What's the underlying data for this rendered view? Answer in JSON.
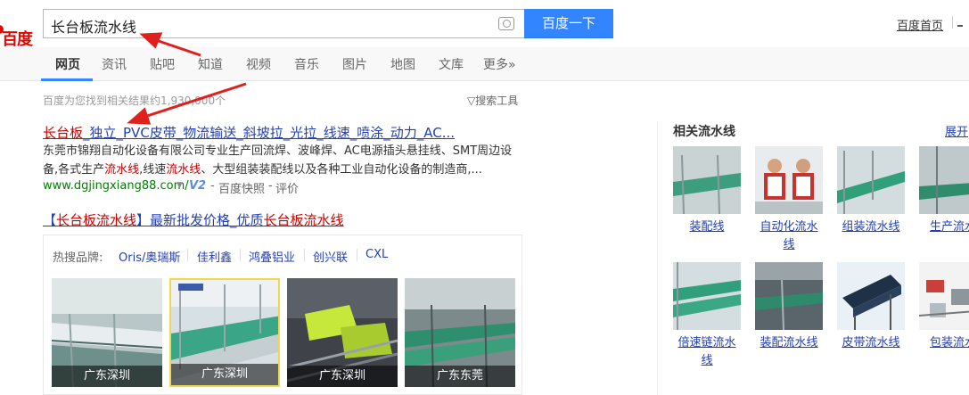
{
  "header": {
    "logo_text": "百度",
    "search_query": "长台板流水线",
    "search_button": "百度一下",
    "link_home": "百度首页"
  },
  "tabs": [
    {
      "label": "网页"
    },
    {
      "label": "资讯"
    },
    {
      "label": "贴吧"
    },
    {
      "label": "知道"
    },
    {
      "label": "视频"
    },
    {
      "label": "音乐"
    },
    {
      "label": "图片"
    },
    {
      "label": "地图"
    },
    {
      "label": "文库"
    },
    {
      "label": "更多»"
    }
  ],
  "result_count": "百度为您找到相关结果约1,930,000个",
  "search_tools": "搜索工具",
  "result1": {
    "title_em": "长台板",
    "title_rest": "_独立_PVC皮带_物流输送_斜坡拉_光拉_线速_喷涂_动力_AC...",
    "abstract_line1": "东莞市锦翔自动化设备有限公司专业生产回流焊、波峰焊、AC电源插头悬挂线、SMT周边设",
    "abstract_line2_a": "备,各式生产",
    "abstract_line2_em1": "流水线",
    "abstract_line2_b": ",线速",
    "abstract_line2_em2": "流水线",
    "abstract_line2_c": "、大型组装装配线以及各种工业自动化设备的制造商,...",
    "url": "www.dgjingxiang88.com/",
    "v2": "V2",
    "snapshot": "百度快照",
    "review": "评价"
  },
  "result2": {
    "title_a": "【",
    "title_em1": "长台板流水线",
    "title_b": "】最新批发价格_优质",
    "title_em2": "长台板流水线"
  },
  "brands": {
    "label": "热搜品牌:",
    "items": [
      "Oris/奥瑞斯",
      "佳利鑫",
      "鸿叠铝业",
      "创兴联",
      "CXL"
    ],
    "thumbs": [
      {
        "caption": "广东深圳"
      },
      {
        "caption": "广东深圳"
      },
      {
        "caption": "广东深圳"
      },
      {
        "caption": "广东东莞"
      }
    ]
  },
  "side": {
    "title": "相关流水线",
    "expand": "展开",
    "row1": [
      {
        "l1": "装配线",
        "l2": ""
      },
      {
        "l1": "自动化流水",
        "l2": "线"
      },
      {
        "l1": "组装流水线",
        "l2": ""
      },
      {
        "l1": "生产流水",
        "l2": ""
      }
    ],
    "row2": [
      {
        "l1": "倍速链流水",
        "l2": "线"
      },
      {
        "l1": "装配流水线",
        "l2": ""
      },
      {
        "l1": "皮带流水线",
        "l2": ""
      },
      {
        "l1": "包装流水",
        "l2": ""
      }
    ]
  },
  "colors": {
    "brand_blue": "#3385ff",
    "link_blue": "#2440b3",
    "highlight_red": "#c00",
    "url_green": "#008000",
    "annotation_red": "#e0201c"
  }
}
